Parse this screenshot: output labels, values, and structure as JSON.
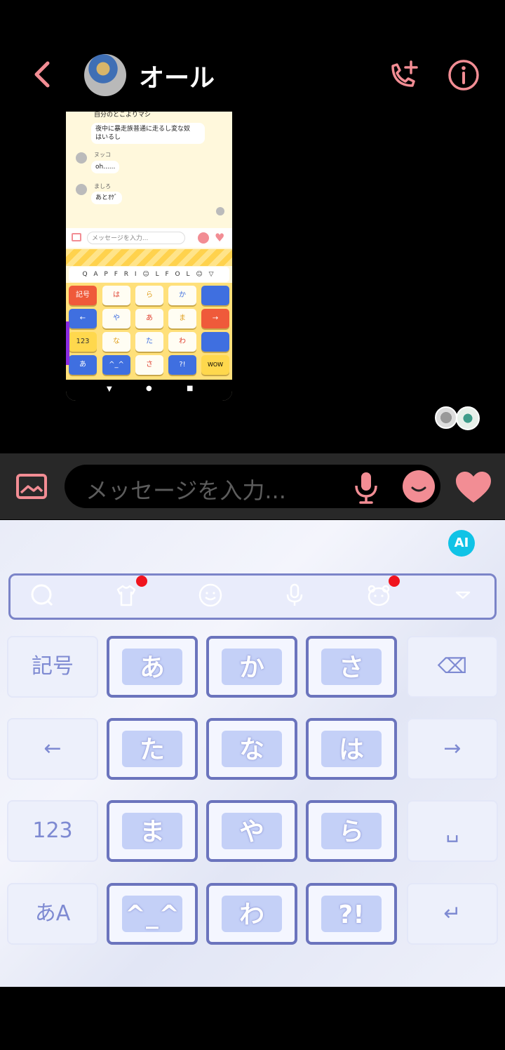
{
  "header": {
    "title": "オール"
  },
  "screenshot_message": {
    "messages": [
      {
        "sender": "",
        "text": "自分のとこよりマシ"
      },
      {
        "sender": "",
        "text": "夜中に暴走族普通に走るし変な奴\nはいるし"
      },
      {
        "sender": "ヌッコ",
        "text": "oh......"
      },
      {
        "sender": "ましろ",
        "text": "あとｵｹﾞ"
      }
    ],
    "input_placeholder": "メッセージを入力...",
    "keyboard_toolbar": "Q A P F R I ☺ L F O L ☺ ▽",
    "keyboard_keys": {
      "row1": [
        "記号",
        "は",
        "ら",
        "か"
      ],
      "row2": [
        "←",
        "や",
        "あ",
        "ま",
        "→"
      ],
      "row3": [
        "123",
        "な",
        "た",
        "わ"
      ],
      "row4": [
        "あ",
        "^_^",
        "さ",
        "?!"
      ]
    },
    "sticker_text": "WOW"
  },
  "input_bar": {
    "placeholder": "メッセージを入力..."
  },
  "keyboard": {
    "ai_label": "AI",
    "rows": [
      {
        "left": "記号",
        "keys": [
          "あ",
          "か",
          "さ"
        ],
        "right": "⌫"
      },
      {
        "left": "←",
        "keys": [
          "た",
          "な",
          "は"
        ],
        "right": "→"
      },
      {
        "left": "123",
        "keys": [
          "ま",
          "や",
          "ら"
        ],
        "right": "␣"
      },
      {
        "left": "あA",
        "keys": [
          "^_^",
          "わ",
          "?!"
        ],
        "right": "↵"
      }
    ]
  },
  "colors": {
    "accent_pink": "#f28d94",
    "key_border": "#6b74bd",
    "ai_badge": "#10c3e6",
    "notify_dot": "#f0141e"
  }
}
